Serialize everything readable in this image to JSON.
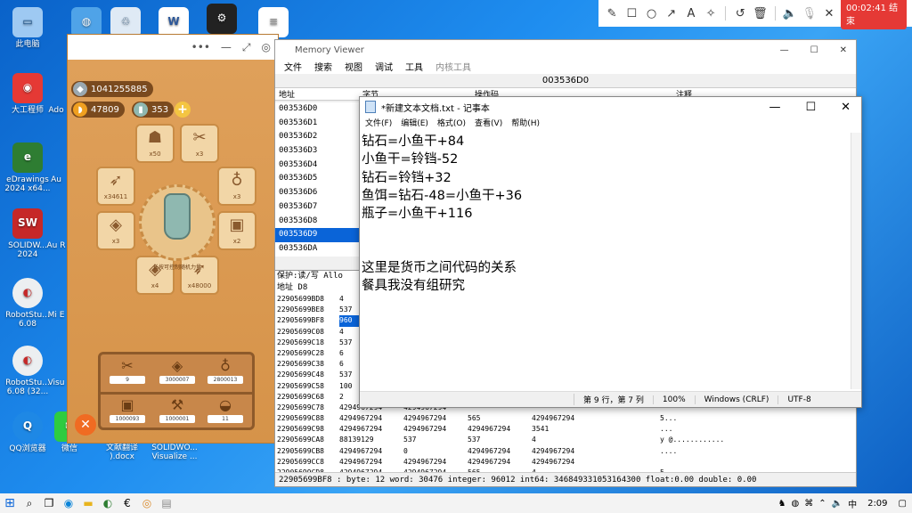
{
  "desktop": {
    "icons": [
      {
        "label": "此电脑"
      },
      {
        "label": "大工程师"
      },
      {
        "label": "eDrawings 2024 x64..."
      },
      {
        "label": "SOLIDW... 2024"
      },
      {
        "label": "RobotStu... 6.08"
      },
      {
        "label": "RobotStu... 6.08 (32..."
      },
      {
        "label": "QQ浏览器"
      },
      {
        "label": "Ado"
      },
      {
        "label": "Au"
      },
      {
        "label": "Au R"
      },
      {
        "label": "Mi E"
      },
      {
        "label": "Visu"
      },
      {
        "label": "微信"
      },
      {
        "label": "文献翻译 ).docx"
      },
      {
        "label": "SOLIDWO... Visualize ..."
      }
    ]
  },
  "recorder": {
    "timer": "00:02:41 结束"
  },
  "game": {
    "currency1": "1041255885",
    "currency2": "47809",
    "currency3": "353",
    "items": [
      {
        "label": "x50"
      },
      {
        "label": "x3"
      },
      {
        "label": "x34611"
      },
      {
        "label": "x3"
      },
      {
        "label": "x3"
      },
      {
        "label": "x2"
      },
      {
        "label": "x4"
      },
      {
        "label": "x48000"
      }
    ],
    "center_caption": "长按可控制随机力量",
    "shelf": [
      {
        "label": "9"
      },
      {
        "label": "3000007"
      },
      {
        "label": "2800013"
      },
      {
        "label": "1000093"
      },
      {
        "label": "1000001"
      },
      {
        "label": "11"
      }
    ]
  },
  "memory_viewer": {
    "title": "Memory Viewer",
    "menu": [
      "文件",
      "搜索",
      "视图",
      "调试",
      "工具",
      "内核工具"
    ],
    "address": "003536D0",
    "col_address": "地址",
    "col_bytes": "字节",
    "col_opcode": "操作码",
    "col_comment": "注释",
    "addresses": [
      "003536D0",
      "003536D1",
      "003536D2",
      "003536D3",
      "003536D4",
      "003536D5",
      "003536D6",
      "003536D7",
      "003536D8",
      "003536D9",
      "003536DA"
    ],
    "selected_address": "003536D9",
    "lower_header_line1": "保护:读/写  Allo",
    "lower_header_line2": "地址         D8",
    "hex_rows": [
      [
        "22905699BD8",
        "4",
        "",
        "",
        "",
        "",
        ""
      ],
      [
        "22905699BE8",
        "537",
        "",
        "",
        "",
        "",
        ""
      ],
      [
        "22905699BF8",
        "960",
        "",
        "",
        "",
        "",
        ""
      ],
      [
        "22905699C08",
        "4",
        "",
        "",
        "",
        "",
        ""
      ],
      [
        "22905699C18",
        "537",
        "",
        "",
        "",
        "",
        ""
      ],
      [
        "22905699C28",
        "6",
        "",
        "",
        "",
        "",
        ""
      ],
      [
        "22905699C38",
        "6",
        "",
        "",
        "",
        "",
        ""
      ],
      [
        "22905699C48",
        "537",
        "",
        "",
        "",
        "",
        ""
      ],
      [
        "22905699C58",
        "100",
        "",
        "",
        "",
        "",
        ""
      ],
      [
        "22905699C68",
        "2",
        "",
        "",
        "",
        "",
        ""
      ],
      [
        "22905699C78",
        "4294967294",
        "4294967294",
        "",
        "",
        "",
        ""
      ],
      [
        "22905699C88",
        "4294967294",
        "4294967294",
        "565",
        "4294967294",
        "",
        "5..."
      ],
      [
        "22905699C98",
        "4294967294",
        "4294967294",
        "4294967294",
        "3541",
        "",
        "..."
      ],
      [
        "22905699CA8",
        "88139129",
        "537",
        "537",
        "4",
        "",
        "y @............"
      ],
      [
        "22905699CB8",
        "4294967294",
        "0",
        "4294967294",
        "4294967294",
        "",
        "...."
      ],
      [
        "22905699CC8",
        "4294967294",
        "4294967294",
        "4294967294",
        "4294967294",
        "",
        ""
      ],
      [
        "22905699CD8",
        "4294967294",
        "4294967294",
        "565",
        "4",
        "",
        "5"
      ]
    ],
    "status": "22905699BF8 : byte: 12 word: 30476 integer: 96012 int64: 346849331053164300 float:0.00 double: 0.00"
  },
  "notepad": {
    "title": "*新建文本文档.txt - 记事本",
    "menu": [
      "文件(F)",
      "编辑(E)",
      "格式(O)",
      "查看(V)",
      "帮助(H)"
    ],
    "lines": [
      "钻石=小鱼干+84",
      "小鱼干=铃铛-52",
      "钻石=铃铛+32",
      "鱼饵=钻石-48=小鱼干+36",
      "瓶子=小鱼干+116",
      "",
      "",
      "这里是货币之间代码的关系",
      "餐具我没有组研究"
    ],
    "status_pos": "第 9 行，第 7 列",
    "status_zoom": "100%",
    "status_eol": "Windows (CRLF)",
    "status_enc": "UTF-8"
  },
  "taskbar": {
    "clock": "2:09"
  }
}
